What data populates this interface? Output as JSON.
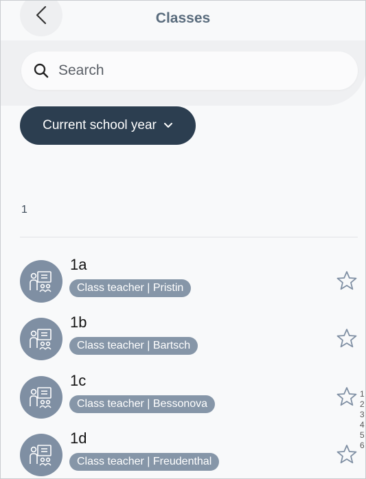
{
  "header": {
    "title": "Classes"
  },
  "search": {
    "placeholder": "Search"
  },
  "filter": {
    "label": "Current school year"
  },
  "section": {
    "label": "1"
  },
  "classes": [
    {
      "name": "1a",
      "teacher": "Class teacher | Pristin"
    },
    {
      "name": "1b",
      "teacher": "Class teacher | Bartsch"
    },
    {
      "name": "1c",
      "teacher": "Class teacher | Bessonova"
    },
    {
      "name": "1d",
      "teacher": "Class teacher | Freudenthal"
    }
  ],
  "index_strip": [
    "1",
    "2",
    "3",
    "4",
    "5",
    "6"
  ],
  "colors": {
    "accent": "#2c3e50",
    "badge": "#8696a8",
    "avatar": "#7f8fa3",
    "title": "#5a6c7d"
  }
}
